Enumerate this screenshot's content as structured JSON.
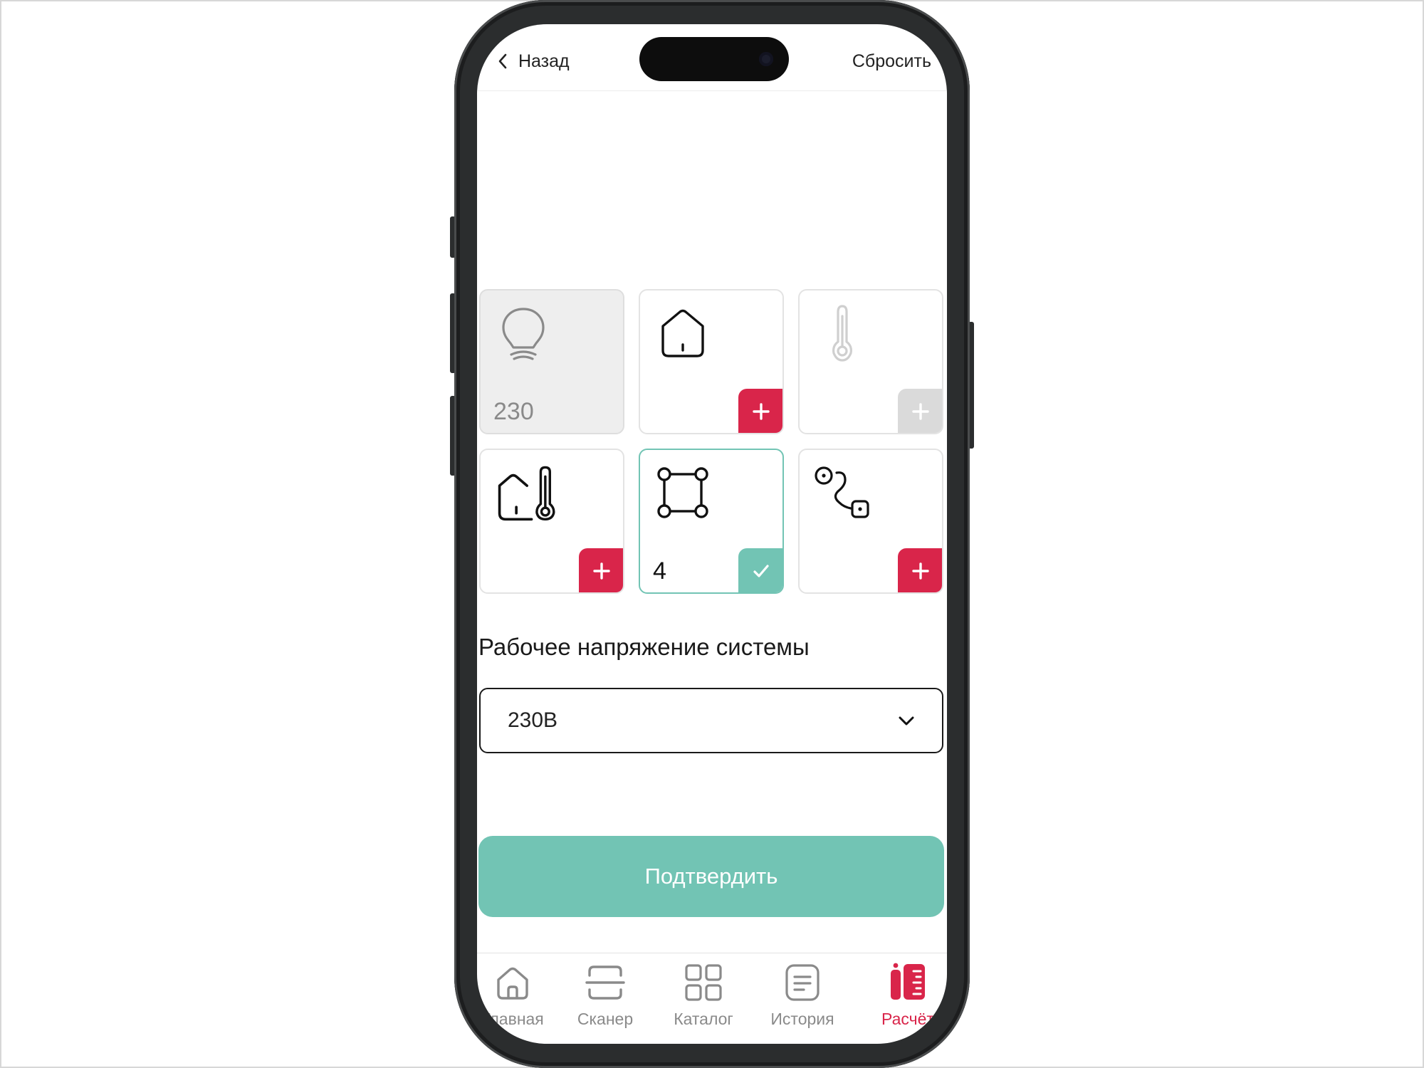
{
  "header": {
    "back_label": "Назад",
    "reset_label": "Сбросить"
  },
  "tiles": [
    {
      "icon": "lightbulb-icon",
      "value": "230",
      "state": "disabled",
      "action_icon": "none"
    },
    {
      "icon": "house-icon",
      "value": "",
      "state": "enabled",
      "action_icon": "plus-icon"
    },
    {
      "icon": "thermometer-icon",
      "value": "",
      "state": "disabled",
      "action_icon": "plus-icon"
    },
    {
      "icon": "house-thermometer-icon",
      "value": "",
      "state": "enabled",
      "action_icon": "plus-icon"
    },
    {
      "icon": "area-square-icon",
      "value": "4",
      "state": "selected",
      "action_icon": "check-icon"
    },
    {
      "icon": "route-icon",
      "value": "",
      "state": "enabled",
      "action_icon": "plus-icon"
    }
  ],
  "voltage": {
    "label": "Рабочее напряжение системы",
    "selected": "230В"
  },
  "confirm_label": "Подтвердить",
  "tabbar": {
    "items": [
      {
        "label": "Главная",
        "icon": "home-icon",
        "active": false
      },
      {
        "label": "Сканер",
        "icon": "scanner-icon",
        "active": false
      },
      {
        "label": "Каталог",
        "icon": "catalog-grid-icon",
        "active": false
      },
      {
        "label": "История",
        "icon": "history-list-icon",
        "active": false
      },
      {
        "label": "Расчёт",
        "icon": "calculation-icon",
        "active": true
      }
    ]
  },
  "colors": {
    "accent_red": "#d9254a",
    "accent_green": "#72c4b4",
    "disabled_grey": "#dadada",
    "text_muted": "#8a8a8a"
  }
}
